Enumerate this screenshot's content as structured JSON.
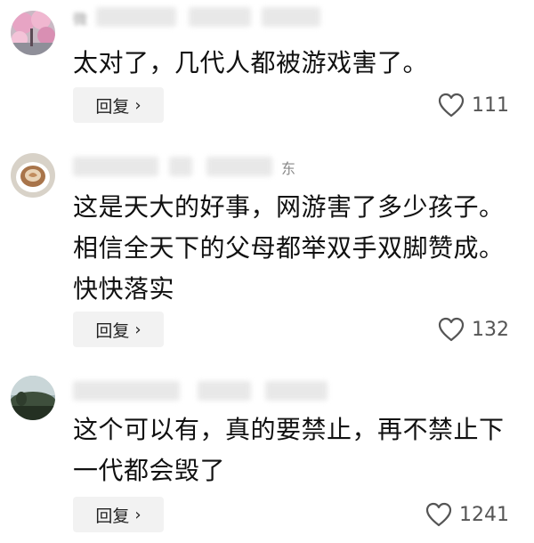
{
  "comments": [
    {
      "avatar": "avatar-pink-blossom",
      "username_visible": "微",
      "text": "太对了，几代人都被游戏害了。",
      "reply_label": "回复",
      "reply_icon": "chevron-right-icon",
      "like_icon": "heart-outline-icon",
      "likes": "111"
    },
    {
      "avatar": "avatar-latte-cup",
      "username_visible": "东",
      "text": "这是天大的好事，网游害了多少孩子。相信全天下的父母都举双手双脚赞成。快快落实",
      "reply_label": "回复",
      "reply_icon": "chevron-right-icon",
      "like_icon": "heart-outline-icon",
      "likes": "132"
    },
    {
      "avatar": "avatar-landscape",
      "username_visible": "",
      "text": "这个可以有，真的要禁止，再不禁止下一代都会毁了",
      "reply_label": "回复",
      "reply_icon": "chevron-right-icon",
      "like_icon": "heart-outline-icon",
      "likes": "1241"
    }
  ]
}
